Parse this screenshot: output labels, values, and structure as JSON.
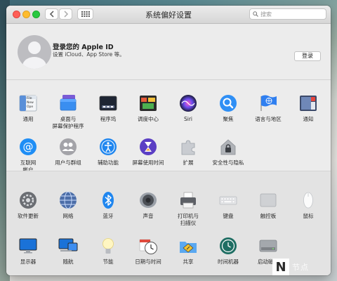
{
  "window": {
    "title": "系统偏好设置",
    "search_placeholder": "搜索"
  },
  "account": {
    "title": "登录您的 Apple ID",
    "subtitle": "设置 iCloud、App Store 等。",
    "login_label": "登录"
  },
  "row1": [
    {
      "label": "通用",
      "icon": "general-icon"
    },
    {
      "label": "桌面与\n屏幕保护程序",
      "icon": "desktop-icon"
    },
    {
      "label": "程序坞",
      "icon": "dock-icon"
    },
    {
      "label": "调度中心",
      "icon": "mission-control-icon"
    },
    {
      "label": "Siri",
      "icon": "siri-icon"
    },
    {
      "label": "聚焦",
      "icon": "spotlight-icon"
    },
    {
      "label": "语言与地区",
      "icon": "language-region-icon"
    },
    {
      "label": "通知",
      "icon": "notifications-icon"
    }
  ],
  "row2": [
    {
      "label": "互联网\n帐户",
      "icon": "internet-accounts-icon"
    },
    {
      "label": "用户与群组",
      "icon": "users-groups-icon"
    },
    {
      "label": "辅助功能",
      "icon": "accessibility-icon"
    },
    {
      "label": "屏幕使用时间",
      "icon": "screen-time-icon"
    },
    {
      "label": "扩展",
      "icon": "extensions-icon"
    },
    {
      "label": "安全性与隐私",
      "icon": "security-privacy-icon"
    }
  ],
  "row3": [
    {
      "label": "软件更新",
      "icon": "software-update-icon"
    },
    {
      "label": "网络",
      "icon": "network-icon"
    },
    {
      "label": "蓝牙",
      "icon": "bluetooth-icon"
    },
    {
      "label": "声音",
      "icon": "sound-icon"
    },
    {
      "label": "打印机与\n扫描仪",
      "icon": "printer-icon"
    },
    {
      "label": "键盘",
      "icon": "keyboard-icon"
    },
    {
      "label": "触控板",
      "icon": "trackpad-icon"
    },
    {
      "label": "鼠标",
      "icon": "mouse-icon"
    }
  ],
  "row4": [
    {
      "label": "显示器",
      "icon": "displays-icon"
    },
    {
      "label": "随航",
      "icon": "sidecar-icon"
    },
    {
      "label": "节能",
      "icon": "energy-saver-icon"
    },
    {
      "label": "日期与时间",
      "icon": "date-time-icon"
    },
    {
      "label": "共享",
      "icon": "sharing-icon"
    },
    {
      "label": "时间机器",
      "icon": "time-machine-icon"
    },
    {
      "label": "启动磁盘",
      "icon": "startup-disk-icon"
    }
  ],
  "general_icon_text": [
    "File",
    "New",
    "Ope"
  ],
  "watermark": {
    "glyph": "N",
    "text": "节点"
  },
  "colors": {
    "accent": "#1a82fb",
    "red": "#fe5f57",
    "yellow": "#febc2e",
    "green": "#28c840"
  }
}
